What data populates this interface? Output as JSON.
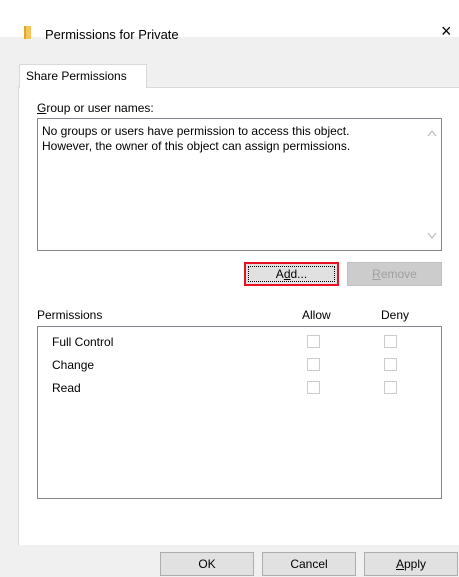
{
  "window": {
    "title": "Permissions for Private",
    "close_glyph": "×"
  },
  "tabs": [
    {
      "label": "Share Permissions"
    }
  ],
  "users_section": {
    "label_prefix_underlined": "G",
    "label_rest": "roup or user names:",
    "message_line1": "No groups or users have permission to access this object.",
    "message_line2": "However, the owner of this object can assign permissions."
  },
  "buttons": {
    "add": {
      "pre": "A",
      "ul": "d",
      "post": "d..."
    },
    "remove": {
      "pre": "",
      "ul": "R",
      "post": "emove"
    },
    "ok": "OK",
    "cancel": "Cancel",
    "apply": {
      "pre": "",
      "ul": "A",
      "post": "pply"
    }
  },
  "permissions": {
    "header": "Permissions",
    "allow_header": "Allow",
    "deny_header": "Deny",
    "rows": [
      {
        "name": "Full Control",
        "allow": false,
        "deny": false
      },
      {
        "name": "Change",
        "allow": false,
        "deny": false
      },
      {
        "name": "Read",
        "allow": false,
        "deny": false
      }
    ]
  },
  "colors": {
    "focus_border": "#e81123",
    "folder_icon": "#f8c55a"
  },
  "icons": [
    "folder-icon",
    "close-icon",
    "scroll-up-icon",
    "scroll-down-icon"
  ]
}
